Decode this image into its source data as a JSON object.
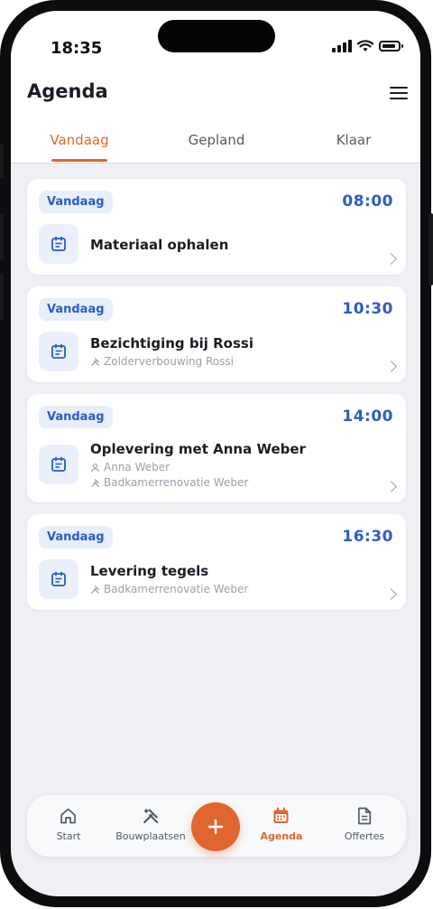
{
  "status": {
    "time": "18:35"
  },
  "header": {
    "title": "Agenda"
  },
  "tabs": [
    {
      "label": "Vandaag",
      "active": true
    },
    {
      "label": "Gepland",
      "active": false
    },
    {
      "label": "Klaar",
      "active": false
    }
  ],
  "appointments": [
    {
      "badge": "Vandaag",
      "time": "08:00",
      "title": "Materiaal ophalen"
    },
    {
      "badge": "Vandaag",
      "time": "10:30",
      "title": "Bezichtiging bij Rossi",
      "project": "Zolderverbouwing Rossi"
    },
    {
      "badge": "Vandaag",
      "time": "14:00",
      "title": "Oplevering met Anna Weber",
      "contact": "Anna Weber",
      "project": "Badkamerrenovatie Weber"
    },
    {
      "badge": "Vandaag",
      "time": "16:30",
      "title": "Levering tegels",
      "project": "Badkamerrenovatie Weber"
    }
  ],
  "nav": [
    {
      "label": "Start",
      "icon": "home-icon"
    },
    {
      "label": "Bouwplaatsen",
      "icon": "tools-icon"
    },
    {
      "label": "Agenda",
      "icon": "calendar-icon",
      "active": true
    },
    {
      "label": "Offertes",
      "icon": "document-icon"
    }
  ],
  "fab": {
    "icon": "plus-icon"
  },
  "colors": {
    "accent": "#e0662e",
    "primary": "#2b5cc8",
    "badge_bg": "#e8eefa"
  }
}
